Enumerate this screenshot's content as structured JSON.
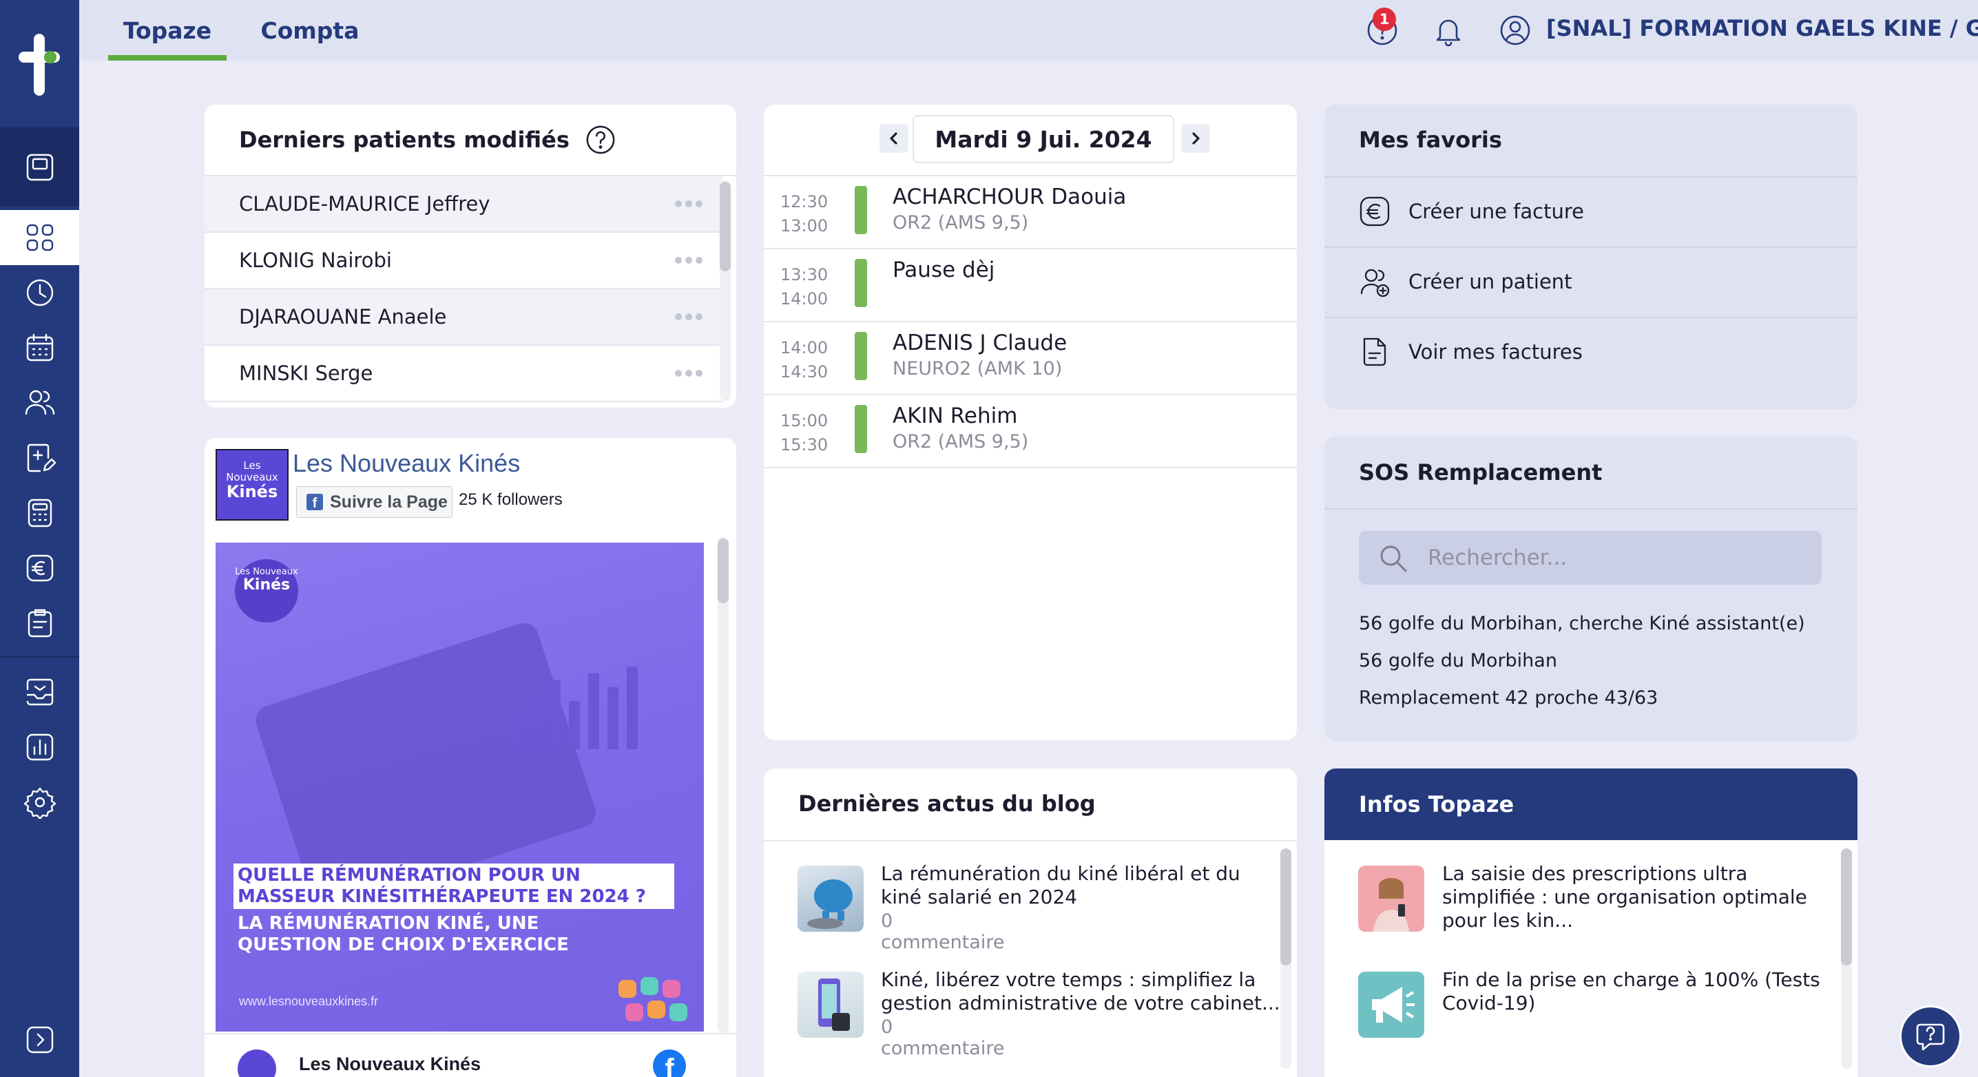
{
  "app": {
    "tabs": [
      {
        "label": "Topaze",
        "active": true
      },
      {
        "label": "Compta",
        "active": false
      }
    ],
    "notification_count": "1",
    "user_label": "[SNAL] FORMATION GAELS KINE / Gael",
    "accent_color": "#243a7c",
    "active_color": "#5dab3e"
  },
  "sidebar": {
    "items": [
      {
        "icon": "tablet-icon"
      },
      {
        "icon": "dashboard-grid-icon"
      },
      {
        "icon": "clock-icon"
      },
      {
        "icon": "calendar-icon"
      },
      {
        "icon": "patients-icon"
      },
      {
        "icon": "prescription-icon"
      },
      {
        "icon": "calculator-icon"
      },
      {
        "icon": "euro-icon"
      },
      {
        "icon": "clipboard-icon"
      },
      {
        "icon": "messages-icon"
      },
      {
        "icon": "stats-icon"
      },
      {
        "icon": "settings-gear-icon"
      },
      {
        "icon": "expand-arrow-icon"
      }
    ]
  },
  "patients": {
    "title": "Derniers patients modifiés",
    "rows": [
      {
        "name": "CLAUDE-MAURICE Jeffrey"
      },
      {
        "name": "KLONIG Nairobi"
      },
      {
        "name": "DJARAOUANE Anaele"
      },
      {
        "name": "MINSKI Serge"
      }
    ]
  },
  "facebook": {
    "page_name": "Les Nouveaux Kinés",
    "follow_label": "Suivre la Page",
    "followers": "25 K followers",
    "logo_small": "Les Nouveaux",
    "logo_big": "Kinés",
    "post": {
      "headline": "QUELLE RÉMUNÉRATION POUR UN MASSEUR KINÉSITHÉRAPEUTE EN 2024 ?",
      "subheadline": "LA RÉMUNÉRATION KINÉ, UNE QUESTION DE CHOIX D'EXERCICE",
      "url": "www.lesnouveauxkines.fr"
    },
    "footer_name": "Les Nouveaux Kinés"
  },
  "agenda": {
    "date": "Mardi 9 Jui. 2024",
    "appointments": [
      {
        "start": "12:30",
        "end": "13:00",
        "name": "ACHARCHOUR Daouia",
        "detail": "OR2 (AMS 9,5)"
      },
      {
        "start": "13:30",
        "end": "14:00",
        "name": "Pause dèj",
        "detail": ""
      },
      {
        "start": "14:00",
        "end": "14:30",
        "name": "ADENIS J Claude",
        "detail": "NEURO2 (AMK 10)"
      },
      {
        "start": "15:00",
        "end": "15:30",
        "name": "AKIN Rehim",
        "detail": "OR2 (AMS 9,5)"
      }
    ]
  },
  "blog": {
    "title": "Dernières actus du blog",
    "items": [
      {
        "title": "La rémunération du kiné libéral et du kiné salarié en 2024",
        "comments": "0 commentaire"
      },
      {
        "title": "Kiné, libérez votre temps : simplifiez la gestion administrative de votre cabinet...",
        "comments": "0 commentaire"
      }
    ]
  },
  "favoris": {
    "title": "Mes favoris",
    "items": [
      {
        "label": "Créer une facture",
        "icon": "euro-circle-icon"
      },
      {
        "label": "Créer un patient",
        "icon": "add-user-icon"
      },
      {
        "label": "Voir mes factures",
        "icon": "invoice-icon"
      }
    ]
  },
  "sos": {
    "title": "SOS Remplacement",
    "search_placeholder": "Rechercher...",
    "results": [
      "56 golfe du Morbihan, cherche Kiné assistant(e)",
      "56 golfe du Morbihan",
      "Remplacement 42 proche 43/63"
    ]
  },
  "infos": {
    "title": "Infos Topaze",
    "items": [
      {
        "title": "La saisie des prescriptions ultra simplifiée : une organisation optimale pour les kin..."
      },
      {
        "title": "Fin de la prise en charge à 100% (Tests Covid-19)"
      }
    ]
  }
}
